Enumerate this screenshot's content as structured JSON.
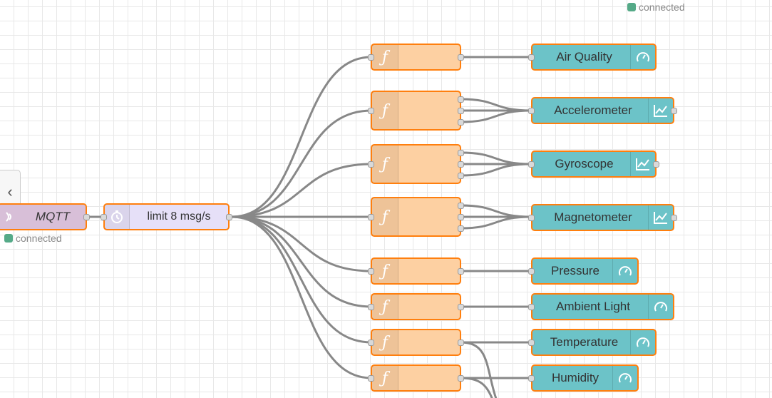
{
  "workspace": {
    "top_status": {
      "text": "connected"
    },
    "sidebar_toggle": {
      "icon": "chevron-left-icon"
    },
    "mqtt_node": {
      "label": "MQTT",
      "status_text": "connected",
      "icon": "wireless-icon"
    },
    "delay_node": {
      "label": "limit 8 msg/s",
      "icon": "timer-icon"
    },
    "function_nodes": [
      {
        "icon": "function-icon",
        "symbol": "ƒ"
      },
      {
        "icon": "function-icon",
        "symbol": "ƒ"
      },
      {
        "icon": "function-icon",
        "symbol": "ƒ"
      },
      {
        "icon": "function-icon",
        "symbol": "ƒ"
      },
      {
        "icon": "function-icon",
        "symbol": "ƒ"
      },
      {
        "icon": "function-icon",
        "symbol": "ƒ"
      },
      {
        "icon": "function-icon",
        "symbol": "ƒ"
      },
      {
        "icon": "function-icon",
        "symbol": "ƒ"
      }
    ],
    "output_nodes": [
      {
        "label": "Air Quality",
        "icon": "gauge-icon"
      },
      {
        "label": "Accelerometer",
        "icon": "chart-icon"
      },
      {
        "label": "Gyroscope",
        "icon": "chart-icon"
      },
      {
        "label": "Magnetometer",
        "icon": "chart-icon"
      },
      {
        "label": "Pressure",
        "icon": "gauge-icon"
      },
      {
        "label": "Ambient Light",
        "icon": "gauge-icon"
      },
      {
        "label": "Temperature",
        "icon": "gauge-icon"
      },
      {
        "label": "Humidity",
        "icon": "gauge-icon"
      }
    ],
    "colors": {
      "node_border": "#ff7f0e",
      "function_fill": "#fdd0a2",
      "dashboard_fill": "#6cc3c8",
      "mqtt_fill": "#d8bfd8",
      "delay_fill": "#e6e0f8",
      "status_connected": "#55aa88",
      "wire": "#888888"
    }
  }
}
